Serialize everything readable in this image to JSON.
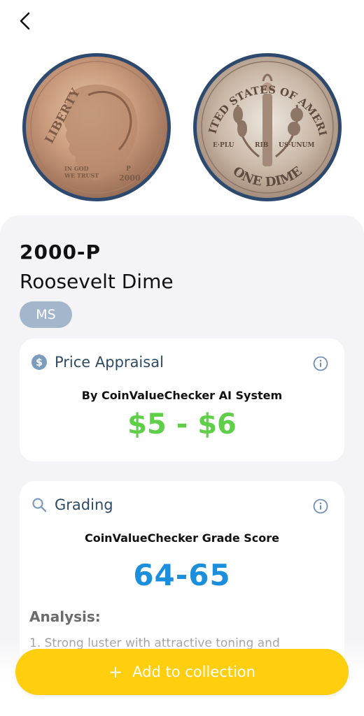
{
  "header": {
    "back_icon": "chevron-left-icon"
  },
  "coin": {
    "obverse": {
      "legend": "LIBERTY",
      "motto": "IN GOD WE TRUST",
      "year": "2000",
      "mint": "P"
    },
    "reverse": {
      "legend": "UNITED STATES OF AMERICA",
      "motto": "E PLURIBUS UNUM",
      "denomination": "ONE DIME"
    }
  },
  "title": {
    "year_mint": "2000-P",
    "name": "Roosevelt Dime",
    "badge": "MS"
  },
  "price_card": {
    "icon": "dollar-circle-icon",
    "title": "Price Appraisal",
    "subtitle": "By CoinValueChecker AI System",
    "value": "$5 - $6",
    "info_icon": "info-icon"
  },
  "grade_card": {
    "icon": "search-icon",
    "title": "Grading",
    "subtitle": "CoinValueChecker Grade Score",
    "value": "64-65",
    "analysis_title": "Analysis:",
    "analysis_text": "1. Strong luster with attractive toning and",
    "info_icon": "info-icon"
  },
  "action": {
    "label": "Add to collection",
    "icon": "plus-icon"
  },
  "colors": {
    "accent_yellow": "#ffcf0f",
    "price_green": "#5fcf4a",
    "grade_blue": "#1b8fdc",
    "badge_blue": "#a4b6cc",
    "title_navy": "#2f4a63"
  }
}
